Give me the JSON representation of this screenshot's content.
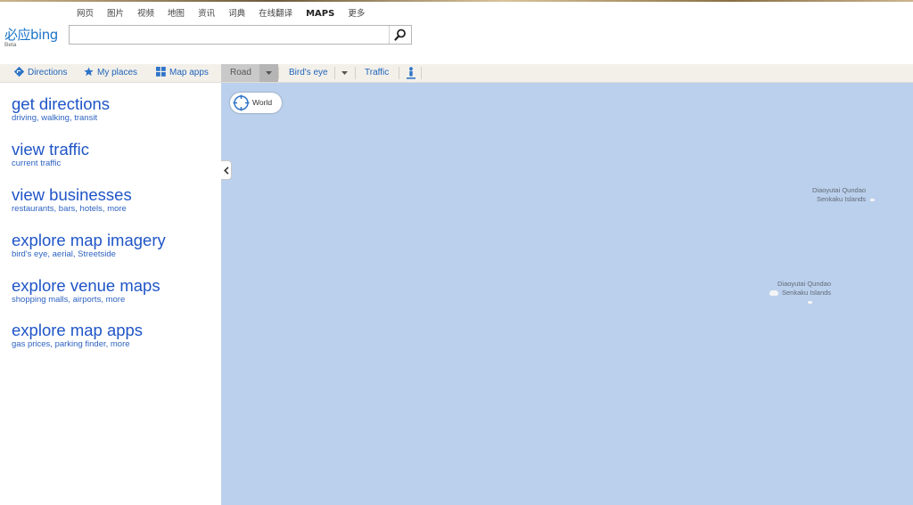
{
  "header": {
    "nav_items": [
      "网页",
      "图片",
      "视频",
      "地图",
      "资讯",
      "词典",
      "在线翻译",
      "MAPS",
      "更多"
    ],
    "active_nav": "MAPS",
    "logo_text": "必应bing",
    "logo_beta": "Beta",
    "search": {
      "value": "",
      "placeholder": ""
    }
  },
  "left_toolbar": {
    "directions": "Directions",
    "my_places": "My places",
    "map_apps": "Map apps"
  },
  "map_toolbar": {
    "road": "Road",
    "birds_eye": "Bird's eye",
    "traffic": "Traffic"
  },
  "left_panel": {
    "items": [
      {
        "title": "get directions",
        "subtitle": "driving, walking, transit"
      },
      {
        "title": "view traffic",
        "subtitle": "current traffic"
      },
      {
        "title": "view businesses",
        "subtitle": "restaurants, bars, hotels, more"
      },
      {
        "title": "explore map imagery",
        "subtitle": "bird's eye, aerial, Streetside"
      },
      {
        "title": "explore venue maps",
        "subtitle": "shopping malls, airports, more"
      },
      {
        "title": "explore map apps",
        "subtitle": "gas prices, parking finder, more"
      }
    ]
  },
  "map": {
    "world_button": "World",
    "labels": [
      {
        "line1": "Diaoyutai Qundao",
        "line2": "Senkaku Islands"
      },
      {
        "line1": "Diaoyutai Qundao",
        "line2": "Senkaku Islands"
      }
    ],
    "colors": {
      "water": "#bbd0ec",
      "link": "#1f55c7"
    }
  }
}
